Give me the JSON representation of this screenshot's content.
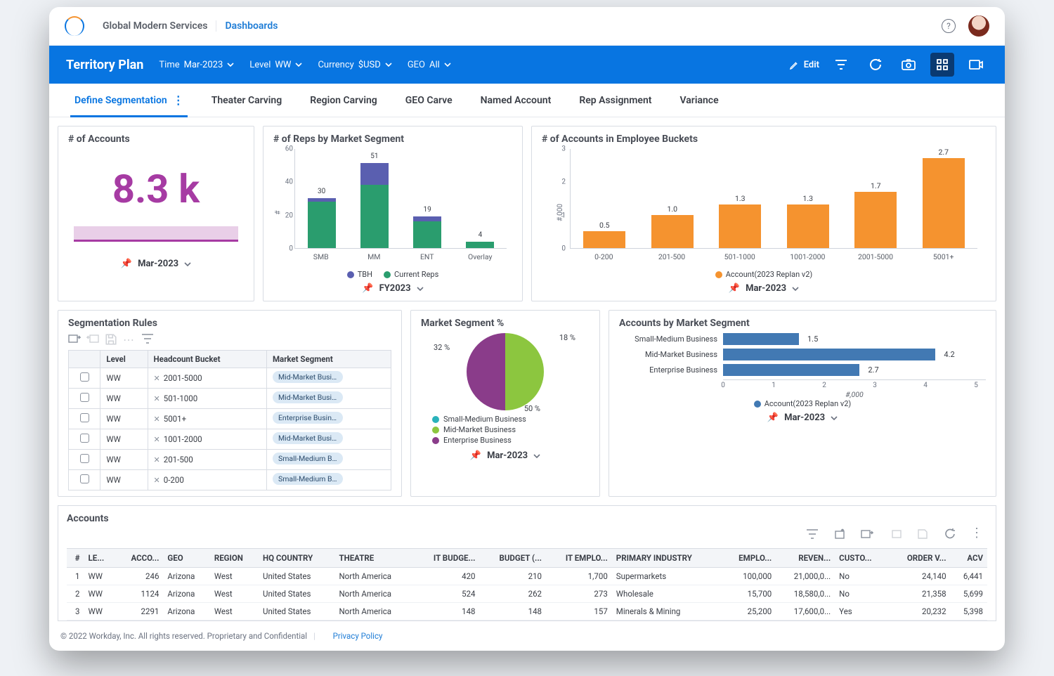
{
  "header": {
    "org": "Global Modern Services",
    "link": "Dashboards"
  },
  "bluebar": {
    "title": "Territory Plan",
    "filters": [
      {
        "label": "Time",
        "value": "Mar-2023"
      },
      {
        "label": "Level",
        "value": "WW"
      },
      {
        "label": "Currency",
        "value": "$USD"
      },
      {
        "label": "GEO",
        "value": "All"
      }
    ],
    "edit": "Edit"
  },
  "tabs": [
    "Define Segmentation",
    "Theater Carving",
    "Region Carving",
    "GEO Carve",
    "Named Account",
    "Rep Assignment",
    "Variance"
  ],
  "cards": {
    "accounts": {
      "title": "# of Accounts",
      "value": "8.3 k",
      "period": "Mar-2023"
    },
    "reps": {
      "title": "# of Reps by Market Segment",
      "period": "FY2023"
    },
    "buckets": {
      "title": "# of Accounts in Employee Buckets",
      "period": "Mar-2023"
    },
    "rules": {
      "title": "Segmentation Rules"
    },
    "mseg": {
      "title": "Market Segment %",
      "period": "Mar-2023"
    },
    "hbar": {
      "title": "Accounts by Market Segment",
      "period": "Mar-2023"
    },
    "acct": {
      "title": "Accounts"
    }
  },
  "chart_data": {
    "reps_by_segment": {
      "type": "bar_stacked",
      "ylabel": "#",
      "ylim": [
        0,
        60
      ],
      "yticks": [
        0,
        20,
        40,
        60
      ],
      "categories": [
        "SMB",
        "MM",
        "ENT",
        "Overlay"
      ],
      "series": [
        {
          "name": "Current Reps",
          "color": "#2a9d6e",
          "values": [
            28,
            38,
            16,
            4
          ]
        },
        {
          "name": "TBH",
          "color": "#5a5fb0",
          "values": [
            2,
            13,
            3,
            0
          ]
        }
      ],
      "totals": [
        30,
        51,
        19,
        4
      ]
    },
    "accounts_employee_buckets": {
      "type": "bar",
      "ylabel": "#,000",
      "ylim": [
        0,
        3
      ],
      "yticks": [
        0,
        1,
        2,
        3
      ],
      "categories": [
        "0-200",
        "201-500",
        "501-1000",
        "1001-2000",
        "2001-5000",
        "5001+"
      ],
      "values": [
        0.5,
        1.0,
        1.3,
        1.3,
        1.7,
        2.7
      ],
      "series_name": "Account(2023 Replan v2)",
      "color": "#f5932f"
    },
    "market_segment_pct": {
      "type": "pie",
      "slices": [
        {
          "name": "Small-Medium Business",
          "value": 18,
          "color": "#29b2bb"
        },
        {
          "name": "Mid-Market Business",
          "value": 50,
          "color": "#8cc63f"
        },
        {
          "name": "Enterprise Business",
          "value": 32,
          "color": "#8a3c8a"
        }
      ],
      "labels": [
        "18 %",
        "50 %",
        "32 %"
      ]
    },
    "accounts_by_segment": {
      "type": "bar_h",
      "xlabel": "#,000",
      "xlim": [
        0,
        5
      ],
      "xticks": [
        0,
        1,
        2,
        3,
        4,
        5
      ],
      "categories": [
        "Small-Medium Business",
        "Mid-Market Business",
        "Enterprise Business"
      ],
      "values": [
        1.5,
        4.2,
        2.7
      ],
      "series_name": "Account(2023 Replan v2)",
      "color": "#4279b3"
    }
  },
  "rules": {
    "cols": [
      "",
      "Level",
      "Headcount Bucket",
      "Market Segment"
    ],
    "rows": [
      {
        "level": "WW",
        "bucket": "2001-5000",
        "seg": "Mid-Market Busi..."
      },
      {
        "level": "WW",
        "bucket": "501-1000",
        "seg": "Mid-Market Busi..."
      },
      {
        "level": "WW",
        "bucket": "5001+",
        "seg": "Enterprise Busin..."
      },
      {
        "level": "WW",
        "bucket": "1001-2000",
        "seg": "Mid-Market Busi..."
      },
      {
        "level": "WW",
        "bucket": "201-500",
        "seg": "Small-Medium B..."
      },
      {
        "level": "WW",
        "bucket": "0-200",
        "seg": "Small-Medium B..."
      }
    ]
  },
  "accounts_table": {
    "cols": [
      "#",
      "LE...",
      "ACCO...",
      "GEO",
      "REGION",
      "HQ COUNTRY",
      "THEATRE",
      "IT BUDGE...",
      "BUDGET (...",
      "IT EMPLO...",
      "PRIMARY INDUSTRY",
      "EMPLO...",
      "REVEN...",
      "CUSTO...",
      "ORDER V...",
      "ACV"
    ],
    "rows": [
      [
        "1",
        "WW",
        "246",
        "Arizona",
        "West",
        "United States",
        "North America",
        "420",
        "210",
        "1,700",
        "Supermarkets",
        "100,000",
        "21,000,0...",
        "No",
        "24,140",
        "6,441"
      ],
      [
        "2",
        "WW",
        "1124",
        "Arizona",
        "West",
        "United States",
        "North America",
        "524",
        "262",
        "273",
        "Wholesale",
        "15,700",
        "18,580,0...",
        "No",
        "21,358",
        "5,699"
      ],
      [
        "3",
        "WW",
        "2291",
        "Arizona",
        "West",
        "United States",
        "North America",
        "148",
        "148",
        "157",
        "Minerals & Mining",
        "25,200",
        "17,600,0...",
        "Yes",
        "20,232",
        "5,398"
      ]
    ]
  },
  "footer": {
    "copy": "© 2022 Workday, Inc. All rights reserved. Proprietary and Confidential",
    "link": "Privacy Policy"
  }
}
